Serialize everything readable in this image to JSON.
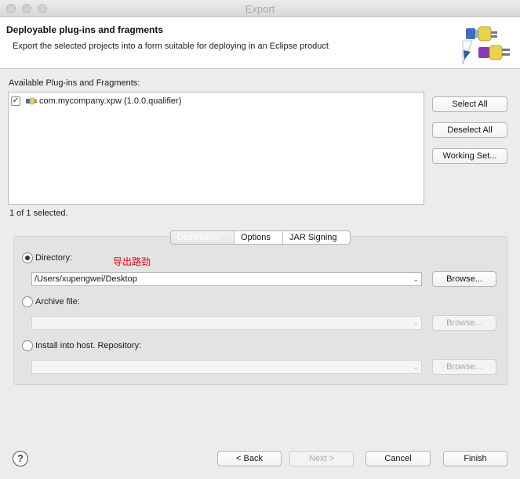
{
  "window": {
    "title": "Export"
  },
  "banner": {
    "title": "Deployable plug-ins and fragments",
    "description": "Export the selected projects into a form suitable for deploying in an Eclipse product"
  },
  "plugins": {
    "label": "Available Plug-ins and Fragments:",
    "items": [
      {
        "label": "com.mycompany.xpw (1.0.0.qualifier)",
        "checked": true
      }
    ],
    "selection_status": "1 of 1 selected."
  },
  "side_buttons": {
    "select_all": "Select All",
    "deselect_all": "Deselect All",
    "working_set": "Working Set..."
  },
  "tabs": [
    "Destination",
    "Options",
    "JAR Signing"
  ],
  "destination": {
    "directory_label": "Directory:",
    "directory_value": "/Users/xupengwei/Desktop",
    "archive_label": "Archive file:",
    "archive_value": "",
    "install_label": "Install into host. Repository:",
    "install_value": "",
    "browse_label": "Browse...",
    "selected": "directory"
  },
  "annotation": "导出路劲",
  "footer": {
    "back": "< Back",
    "next": "Next >",
    "cancel": "Cancel",
    "finish": "Finish",
    "help": "?"
  }
}
